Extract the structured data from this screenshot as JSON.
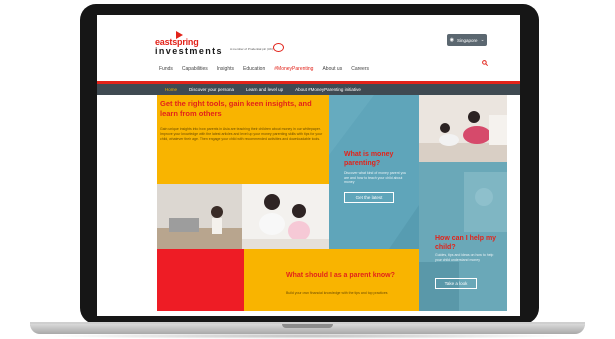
{
  "header": {
    "logo_top": "eastspring",
    "logo_bottom": "investments",
    "tagline": "A member of Prudential plc (UK)",
    "region_label": "Singapore",
    "nav": [
      "Funds",
      "Capabilities",
      "Insights",
      "Education",
      "#MoneyParenting",
      "About us",
      "Careers"
    ],
    "active_nav": "#MoneyParenting"
  },
  "subnav": [
    "Home",
    "Discover your persona",
    "Learn and level up",
    "About #MoneyParenting initiative"
  ],
  "hero": {
    "title": "Get the right tools, gain keen insights, and learn from others",
    "body": "Gain unique insights into how parents in Asia are teaching their children about money in our whitepaper. Improve your knowledge with the latest articles and level up your money parenting skills with tips for your child, whatever their age. Then engage your child with recommended activities and downloadable tools."
  },
  "persona_tile": {
    "title": "What is money parenting?",
    "body": "Discover what kind of money parent you are and how to teach your child about money",
    "button": "Get the latest"
  },
  "help_tile": {
    "title": "How can I help my child?",
    "body": "Guides, tips and ideas on how to help your child understand money",
    "button": "Take a look"
  },
  "parent_tile": {
    "title": "What should I as a parent know?",
    "body": "Build your own financial knowledge with the tips and top practices"
  },
  "colors": {
    "brand_red": "#e2231a",
    "yellow": "#f9b400",
    "teal": "#5fa5ba",
    "subnav_bg": "#3f4a52"
  }
}
